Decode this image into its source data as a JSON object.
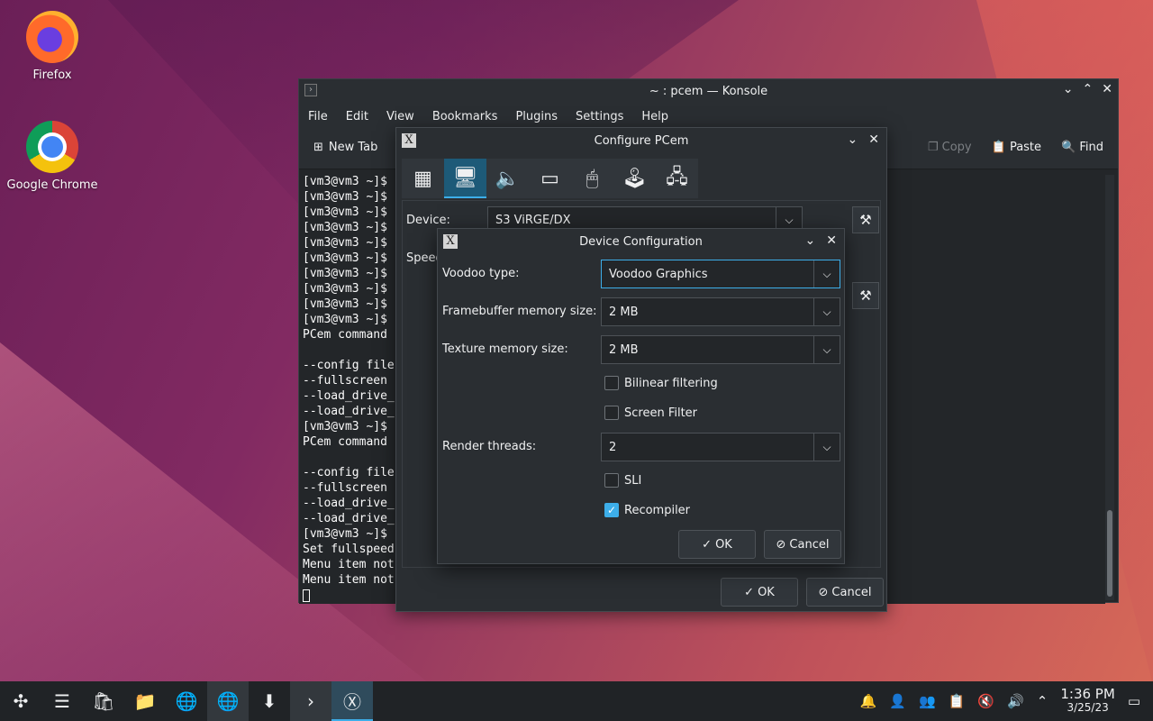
{
  "desktop": {
    "icons": [
      {
        "label": "Firefox"
      },
      {
        "label": "Google Chrome"
      }
    ]
  },
  "konsole": {
    "title": "~ : pcem — Konsole",
    "menu": [
      "File",
      "Edit",
      "View",
      "Bookmarks",
      "Plugins",
      "Settings",
      "Help"
    ],
    "toolbar": {
      "new_tab": "New Tab",
      "copy": "Copy",
      "paste": "Paste",
      "find": "Find"
    },
    "terminal_lines": [
      "[vm3@vm3 ~]$",
      "[vm3@vm3 ~]$",
      "[vm3@vm3 ~]$",
      "[vm3@vm3 ~]$",
      "[vm3@vm3 ~]$",
      "[vm3@vm3 ~]$",
      "[vm3@vm3 ~]$",
      "[vm3@vm3 ~]$",
      "[vm3@vm3 ~]$",
      "[vm3@vm3 ~]$",
      "PCem command",
      "",
      "--config file",
      "--fullscreen",
      "--load_drive_",
      "--load_drive_",
      "[vm3@vm3 ~]$",
      "PCem command",
      "",
      "--config file",
      "--fullscreen",
      "--load_drive_",
      "--load_drive_",
      "[vm3@vm3 ~]$",
      "Set fullspeed",
      "Menu item not",
      "Menu item not"
    ]
  },
  "configure": {
    "title": "Configure PCem",
    "device_label": "Device:",
    "device_value": "S3 ViRGE/DX",
    "speed_label": "Speed",
    "ok": "OK",
    "cancel": "Cancel"
  },
  "device_config": {
    "title": "Device Configuration",
    "voodoo_type_label": "Voodoo type:",
    "voodoo_type_value": "Voodoo Graphics",
    "framebuffer_label": "Framebuffer memory size:",
    "framebuffer_value": "2 MB",
    "texture_label": "Texture memory size:",
    "texture_value": "2 MB",
    "bilinear_label": "Bilinear filtering",
    "screen_filter_label": "Screen Filter",
    "render_threads_label": "Render threads:",
    "render_threads_value": "2",
    "sli_label": "SLI",
    "recompiler_label": "Recompiler",
    "ok": "OK",
    "cancel": "Cancel"
  },
  "taskbar": {
    "time": "1:36 PM",
    "date": "3/25/23"
  }
}
